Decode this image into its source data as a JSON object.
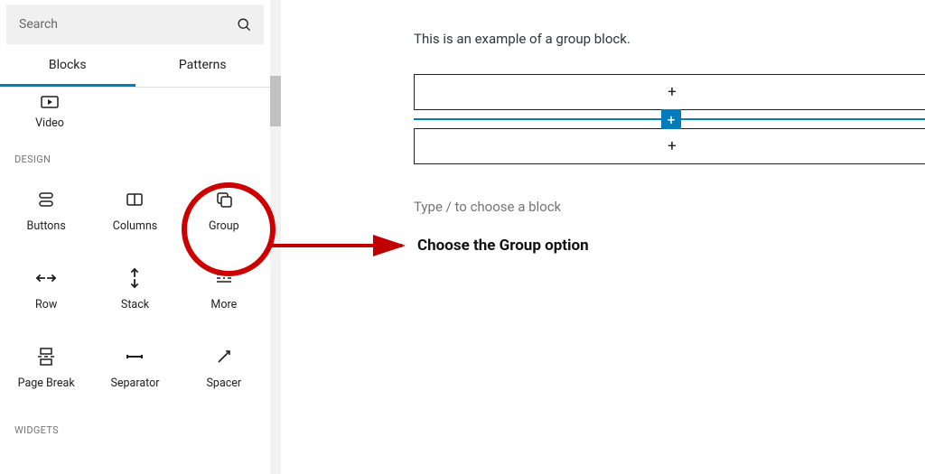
{
  "colors": {
    "accent": "#007cba",
    "annotation": "#c00000"
  },
  "search": {
    "placeholder": "Search"
  },
  "tabs": {
    "blocks": "Blocks",
    "patterns": "Patterns",
    "active": "blocks"
  },
  "partial_block": {
    "label": "Video",
    "icon_name": "video-icon"
  },
  "design": {
    "heading": "Design",
    "items": [
      {
        "label": "Buttons",
        "icon": "buttons"
      },
      {
        "label": "Columns",
        "icon": "columns"
      },
      {
        "label": "Group",
        "icon": "group"
      },
      {
        "label": "Row",
        "icon": "row"
      },
      {
        "label": "Stack",
        "icon": "stack"
      },
      {
        "label": "More",
        "icon": "more"
      },
      {
        "label": "Page Break",
        "icon": "pagebreak"
      },
      {
        "label": "Separator",
        "icon": "separator"
      },
      {
        "label": "Spacer",
        "icon": "spacer"
      }
    ]
  },
  "widgets": {
    "heading": "Widgets"
  },
  "canvas": {
    "example_text": "This is an example of a group block.",
    "prompt_text": "Type / to choose a block"
  },
  "annotation": {
    "label": "Choose the Group option"
  }
}
